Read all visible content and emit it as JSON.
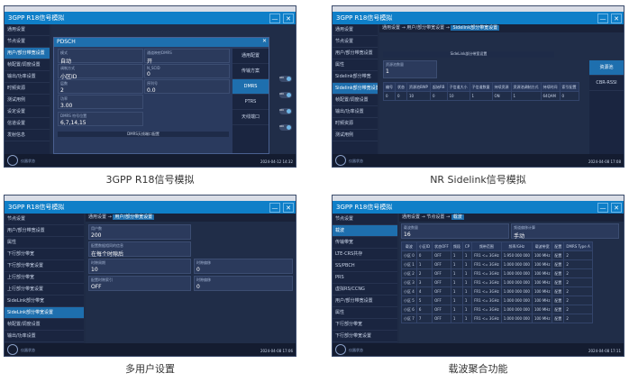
{
  "panels": {
    "p1": {
      "app_title": "3GPP R18信号模拟",
      "sidebar": [
        "通用设置",
        "节点设置",
        "用户/部分带宽设置",
        "帧配置/调度设置",
        "输出/功率设置",
        "时频资源",
        "测试用例",
        "设定设置",
        "信道设置",
        "发射信息"
      ],
      "dialog_title": "PDSCH",
      "fields": [
        {
          "label": "模式",
          "value": "自动"
        },
        {
          "label": "调制方式",
          "value": "小区ID"
        },
        {
          "label": "层数",
          "value": "2"
        },
        {
          "label": "功率",
          "value": "3.00"
        },
        {
          "label": "DMRS 符号位置",
          "value": "6,7,14,15"
        }
      ],
      "right_fields": [
        {
          "label": "通道映射DMRS",
          "value": "开"
        },
        {
          "label": "N_SCID",
          "value": "0"
        },
        {
          "label": "序列号",
          "value": "0.0"
        }
      ],
      "unit_db": "dB",
      "dmrs_bar": "DMRS天线端口配置",
      "right_menu": [
        "通用配置",
        "传输方案",
        "DMRS",
        "PTRS",
        "天线端口"
      ],
      "toggles": [
        "ON",
        "ON",
        "ON",
        "ON"
      ],
      "clock": "2024-04-12 14:32"
    },
    "p2": {
      "app_title": "3GPP R18信号模拟",
      "sidebar": [
        "通用设置",
        "节点设置",
        "用户/部分带宽设置",
        "属性",
        "Sidelink部分带宽",
        "Sidelink部分带宽设置",
        "帧配置/调度设置",
        "输出/功率设置",
        "时频资源",
        "测试用例"
      ],
      "crumb": [
        "通用设置",
        "用户/部分带宽设置",
        "Sidelink部分带宽设置"
      ],
      "subtitle": "SideLink部分带宽设置",
      "count_label": "资源池数量",
      "count_value": "1",
      "table_headers": [
        "编号",
        "状态",
        "资源池BWP",
        "起始RB",
        "子信道大小",
        "子信道数量",
        "持续资源",
        "资源池调制方式",
        "持续时间",
        "索引配置"
      ],
      "table_row": [
        "0",
        "0",
        "10",
        "0",
        "10",
        "1",
        "ON",
        "1",
        "64QAM",
        "0"
      ],
      "right_menu": [
        "资源池",
        "CBR-RSSI"
      ],
      "clock": "2024-04-08 17:08"
    },
    "p3": {
      "app_title": "3GPP R18信号模拟",
      "sidebar": [
        "节点设置",
        "用户/部分带宽设置",
        "属性",
        "下行部分带宽",
        "下行部分带宽设置",
        "上行部分带宽",
        "上行部分带宽设置",
        "SideLink部分带宽",
        "SideLink部分带宽设置",
        "帧配置/调度设置",
        "输出/功率设置"
      ],
      "crumb": [
        "通用设置",
        "用户/部分带宽设置"
      ],
      "fields": [
        {
          "label": "用户数",
          "value": "200"
        },
        {
          "label": "配置数据相同的信息",
          "value": "在每个时隙后"
        },
        {
          "label": "时隙周期",
          "value": "10"
        },
        {
          "label": "配置时隙索引",
          "value": "OFF"
        }
      ],
      "right_fields": [
        {
          "label": "时隙偏移",
          "value": "0"
        },
        {
          "label": "时隙偏移",
          "value": "0"
        }
      ],
      "clock": "2024-04-08 17:06"
    },
    "p4": {
      "app_title": "3GPP R18信号模拟",
      "sidebar": [
        "节点设置",
        "载波",
        "传输带宽",
        "LTE-CRS共存",
        "SS/PBCH",
        "PRS",
        "虚拟RS/CCNG",
        "用户/部分带宽设置",
        "属性",
        "下行部分带宽",
        "下行部分带宽设置"
      ],
      "crumb": [
        "通用设置",
        "节点设置",
        "载波"
      ],
      "count_label": "载波数量",
      "count_value": "16",
      "mode_label": "频道偏移计算",
      "mode_value": "手动",
      "table_headers": [
        "载波",
        "小区ID",
        "状态OFF",
        "频段",
        "CP",
        "频带范围",
        "频率/GHz",
        "载波带宽",
        "配置",
        "DMRS Type A"
      ],
      "rows": [
        [
          "小区 0",
          "0",
          "OFF",
          "1",
          "1",
          "FR1 <= 3GHz",
          "1.950 000 000",
          "100 MHz",
          "配置",
          "2"
        ],
        [
          "小区 1",
          "1",
          "OFF",
          "1",
          "1",
          "FR1 <= 3GHz",
          "1.000 000 000",
          "100 MHz",
          "配置",
          "2"
        ],
        [
          "小区 2",
          "2",
          "OFF",
          "1",
          "1",
          "FR1 <= 3GHz",
          "1.000 000 000",
          "100 MHz",
          "配置",
          "2"
        ],
        [
          "小区 3",
          "3",
          "OFF",
          "1",
          "1",
          "FR1 <= 3GHz",
          "1.000 000 000",
          "100 MHz",
          "配置",
          "2"
        ],
        [
          "小区 4",
          "4",
          "OFF",
          "1",
          "1",
          "FR1 <= 3GHz",
          "1.000 000 000",
          "100 MHz",
          "配置",
          "2"
        ],
        [
          "小区 5",
          "5",
          "OFF",
          "1",
          "1",
          "FR1 <= 3GHz",
          "1.000 000 000",
          "100 MHz",
          "配置",
          "2"
        ],
        [
          "小区 6",
          "6",
          "OFF",
          "1",
          "1",
          "FR1 <= 3GHz",
          "1.000 000 000",
          "100 MHz",
          "配置",
          "2"
        ],
        [
          "小区 7",
          "7",
          "OFF",
          "1",
          "1",
          "FR1 <= 3GHz",
          "1.000 000 000",
          "100 MHz",
          "配置",
          "2"
        ]
      ],
      "clock": "2024-04-08 17:11"
    }
  },
  "captions": [
    "3GPP R18信号模拟",
    "NR Sidelink信号模拟",
    "多用户设置",
    "载波聚合功能"
  ],
  "common": {
    "bottom_text": "仪器状态",
    "minimize": "—",
    "close": "✕"
  }
}
